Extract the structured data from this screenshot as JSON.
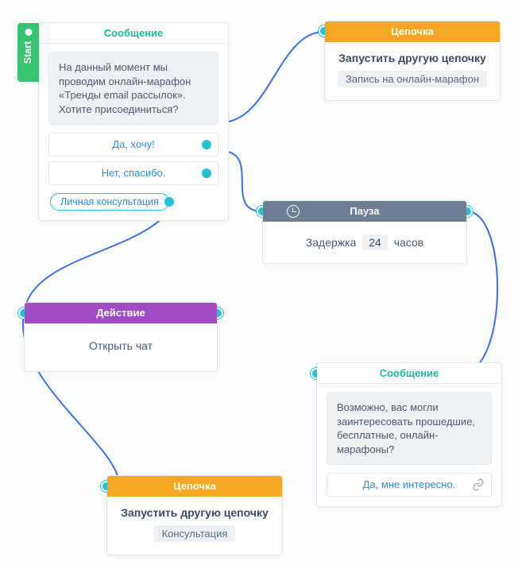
{
  "start_label": "Start",
  "node_message1": {
    "header": "Сообщение",
    "text": "На данный момент мы проводим онлайн-марафон «Тренды email рассылок». Хотите присоединиться?",
    "options": [
      {
        "label": "Да, хочу!"
      },
      {
        "label": "Нет, спасибо."
      }
    ],
    "pill": "Личная консультация"
  },
  "node_chain_top": {
    "header": "Цепочка",
    "title": "Запустить другую цепочку",
    "chip": "Запись на онлайн-марафон"
  },
  "node_pause": {
    "header": "Пауза",
    "prefix": "Задержка",
    "value": "24",
    "suffix": "часов"
  },
  "node_action": {
    "header": "Действие",
    "text": "Открыть чат"
  },
  "node_message2": {
    "header": "Сообщение",
    "text": "Возможно, вас могли заинтересовать прошедшие, бесплатные, онлайн-марафоны?",
    "option": "Да, мне интересно."
  },
  "node_chain_bottom": {
    "header": "Цепочка",
    "title": "Запустить другую цепочку",
    "chip": "Консультация"
  }
}
